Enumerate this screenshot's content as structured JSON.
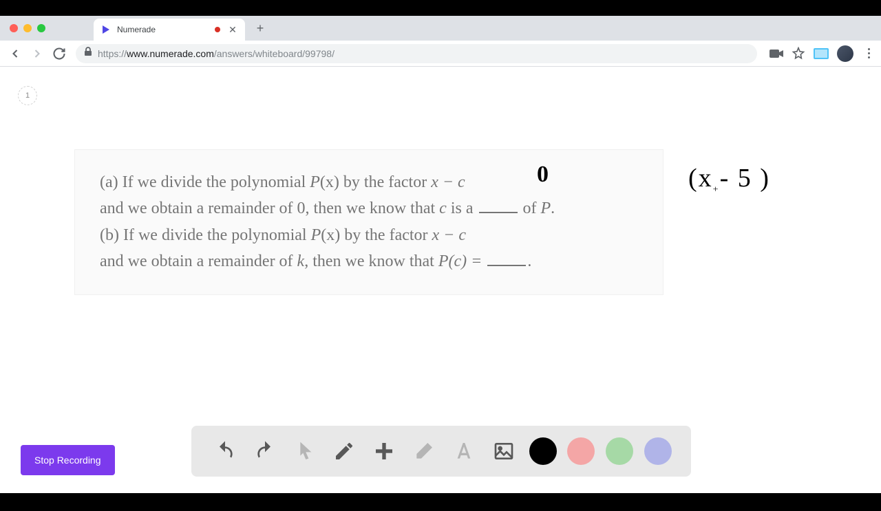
{
  "browser": {
    "tab_title": "Numerade",
    "url_protocol": "https://",
    "url_domain": "www.numerade.com",
    "url_path": "/answers/whiteboard/99798/"
  },
  "page": {
    "badge": "1"
  },
  "problem": {
    "line_a1": "(a) If we divide the polynomial ",
    "px": "P",
    "x_paren": "(x)",
    "by_factor": " by the factor ",
    "xminusc": "x − c",
    "line_a2_pre": "and we obtain a remainder of ",
    "zero": "0",
    "line_a2_mid": ", then we know that ",
    "c_var": "c",
    "is_a": " is a ",
    "of": " of ",
    "P_end": "P",
    "period": ".",
    "line_b1": "(b) If we divide the polynomial ",
    "line_b2_pre": "and we obtain a remainder of ",
    "k_var": "k",
    "pc_eq": "P(c) = ",
    "then_know": ", then we know that "
  },
  "annotations": {
    "zero_fill": "0",
    "side_note": "(x - 5 )"
  },
  "controls": {
    "stop_recording": "Stop Recording"
  },
  "colors": {
    "primary": "#7c3aed"
  }
}
